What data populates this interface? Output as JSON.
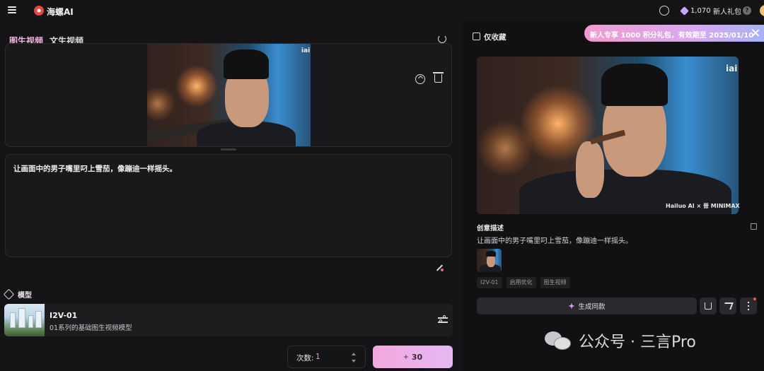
{
  "topbar": {
    "brand": "海螺AI",
    "points": "1,070",
    "gift_label": "新人礼包",
    "help": "?"
  },
  "left": {
    "tabs": [
      {
        "label": "图生视频"
      },
      {
        "label": "文生视频"
      }
    ],
    "prompt": "让画面中的男子嘴里叼上雪茄，像蹦迪一样摇头。",
    "model_section": "模型",
    "model": {
      "name": "I2V-01",
      "desc": "01系列的基础图生视频模型"
    },
    "count_label": "次数:",
    "count_value": "1",
    "generate_cost": "30"
  },
  "right": {
    "fav_label": "仅收藏",
    "promo": "新人专享 1000 积分礼包，有效期至 2025/01/10",
    "video_watermark": "iai",
    "video_footer": "Hailuo AI × 卌 MINIMAX",
    "desc_title": "创意描述",
    "desc_text": "让画面中的男子嘴里叼上雪茄，像蹦迪一样摇头。",
    "tags": [
      "I2V-01",
      "启用优化",
      "图生视频"
    ],
    "same_button": "生成同款"
  },
  "wechat": {
    "label": "公众号 · 三言Pro"
  },
  "colors": {
    "accent_pink": "#f2a8dd",
    "promo_start": "#f29bcf",
    "promo_end": "#a8b2f8"
  }
}
